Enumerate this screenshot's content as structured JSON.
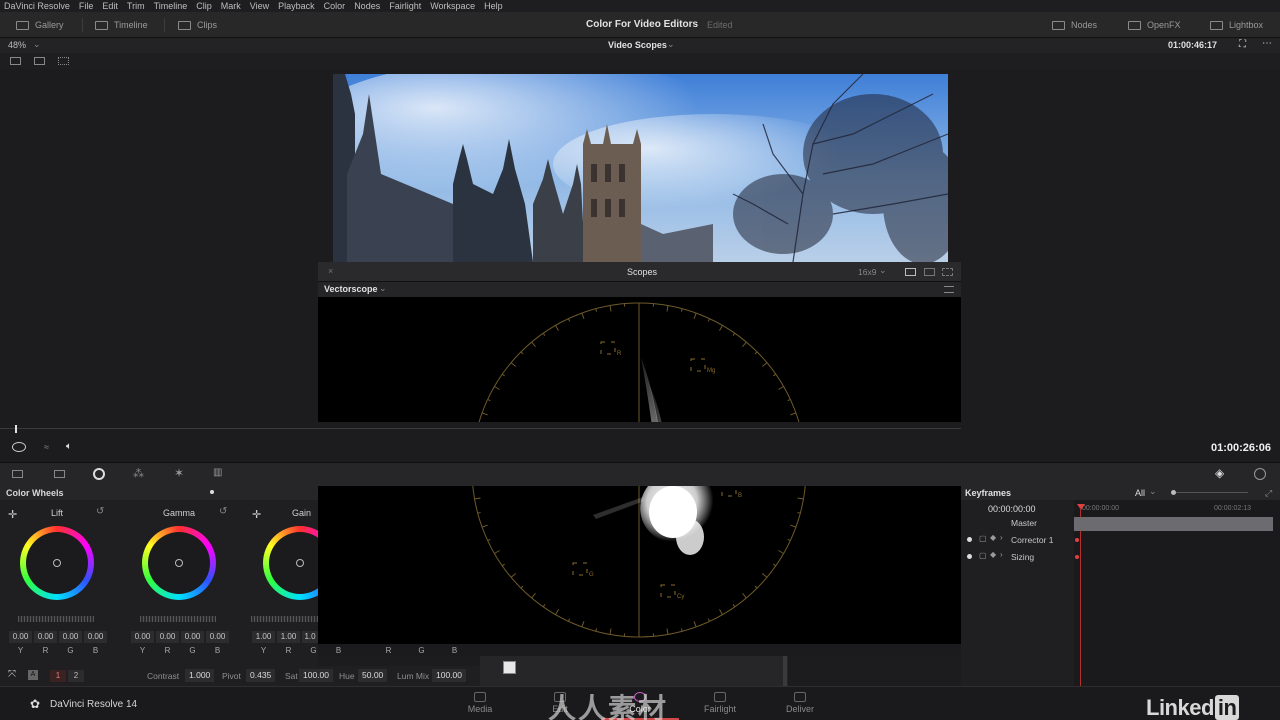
{
  "menubar": [
    "DaVinci Resolve",
    "File",
    "Edit",
    "Trim",
    "Timeline",
    "Clip",
    "Mark",
    "View",
    "Playback",
    "Color",
    "Nodes",
    "Fairlight",
    "Workspace",
    "Help"
  ],
  "toolbar": {
    "gallery": "Gallery",
    "timeline": "Timeline",
    "clips": "Clips",
    "project_title": "Color For Video Editors",
    "project_status": "Edited",
    "nodes": "Nodes",
    "openfx": "OpenFX",
    "lightbox": "Lightbox"
  },
  "viewer": {
    "zoom": "48%",
    "mode": "Video Scopes",
    "timecode_top": "01:00:46:17",
    "timecode_main": "01:00:26:06"
  },
  "scopes": {
    "title": "Scopes",
    "aspect": "16x9",
    "scope_type": "Vectorscope",
    "targets": [
      "R",
      "Mg",
      "B",
      "Cy",
      "G",
      "Yl"
    ]
  },
  "color_wheels": {
    "title": "Color Wheels",
    "wheels": [
      {
        "label": "Lift",
        "values": [
          "0.00",
          "0.00",
          "0.00",
          "0.00"
        ]
      },
      {
        "label": "Gamma",
        "values": [
          "0.00",
          "0.00",
          "0.00",
          "0.00"
        ]
      },
      {
        "label": "Gain",
        "values": [
          "1.00",
          "1.00",
          "1.0"
        ]
      }
    ],
    "channels": [
      "Y",
      "R",
      "G",
      "B"
    ],
    "page1": "1",
    "page2": "2",
    "params": {
      "contrast_label": "Contrast",
      "contrast": "1.000",
      "pivot_label": "Pivot",
      "pivot": "0.435",
      "sat_label": "Sat",
      "sat": "100.00",
      "hue_label": "Hue",
      "hue": "50.00",
      "lummix_label": "Lum Mix",
      "lummix": "100.00"
    },
    "extra_channels": [
      "R",
      "G",
      "B"
    ]
  },
  "keyframes": {
    "title": "Keyframes",
    "filter": "All",
    "tc_start": "00:00:00:00",
    "ruler_start": "00:00:00:00",
    "ruler_end": "00:00:02:13",
    "rows": [
      "Master",
      "Corrector 1",
      "Sizing"
    ]
  },
  "pagenav": {
    "app": "DaVinci Resolve 14",
    "pages": [
      "Media",
      "Edit",
      "Color",
      "Fairlight",
      "Deliver"
    ],
    "active": "Color",
    "brand": "Linked",
    "brand_in": "in",
    "watermark": "人人素材"
  }
}
